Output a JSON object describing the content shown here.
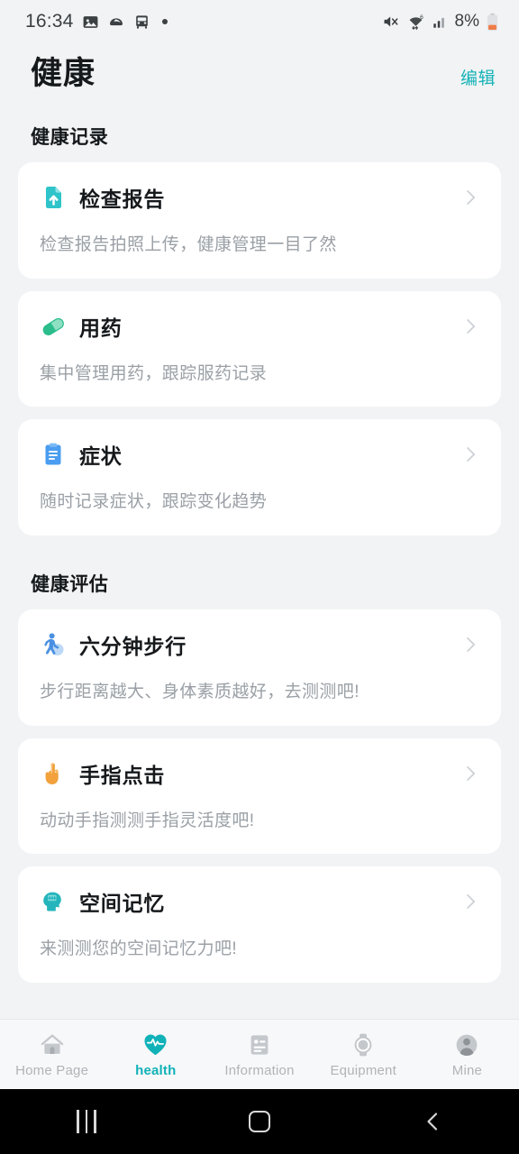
{
  "statusbar": {
    "time": "16:34",
    "left_icons": [
      "image-icon",
      "capsule-icon",
      "bus-icon",
      "dot-indicator"
    ],
    "right_icons": [
      "mute-icon",
      "wifi-icon",
      "signal-icon",
      "battery-icon"
    ],
    "battery_text": "8%",
    "battery_color": "#ef7c48"
  },
  "header": {
    "title": "健康",
    "edit_label": "编辑",
    "accent_color": "#16b3b8"
  },
  "sections": [
    {
      "id": "health-records",
      "title": "健康记录",
      "cards": [
        {
          "id": "inspection-report",
          "icon": "document-upload-icon",
          "icon_color": "#2ec4c9",
          "title": "检查报告",
          "desc": "检查报告拍照上传，健康管理一目了然"
        },
        {
          "id": "medication",
          "icon": "pill-capsule-icon",
          "icon_color": "#2bbd8c",
          "title": "用药",
          "desc": "集中管理用药，跟踪服药记录"
        },
        {
          "id": "symptoms",
          "icon": "clipboard-icon",
          "icon_color": "#4a9df0",
          "title": "症状",
          "desc": "随时记录症状，跟踪变化趋势"
        }
      ]
    },
    {
      "id": "health-assessment",
      "title": "健康评估",
      "cards": [
        {
          "id": "six-minute-walk",
          "icon": "walking-person-icon",
          "icon_color": "#4a90e2",
          "title": "六分钟步行",
          "desc": "步行距离越大、身体素质越好，去测测吧!"
        },
        {
          "id": "finger-tap",
          "icon": "pointing-hand-icon",
          "icon_color": "#f2a13c",
          "title": "手指点击",
          "desc": "动动手指测测手指灵活度吧!"
        },
        {
          "id": "spatial-memory",
          "icon": "brain-head-icon",
          "icon_color": "#23b5bb",
          "title": "空间记忆",
          "desc": "来测测您的空间记忆力吧!"
        }
      ]
    }
  ],
  "tabbar": {
    "active_color": "#10b2b8",
    "inactive_color": "#b0b4b8",
    "items": [
      {
        "id": "home",
        "icon": "home-icon",
        "label": "Home Page",
        "active": false
      },
      {
        "id": "health",
        "icon": "heart-pulse-icon",
        "label": "health",
        "active": true
      },
      {
        "id": "information",
        "icon": "id-card-icon",
        "label": "Information",
        "active": false
      },
      {
        "id": "equipment",
        "icon": "watch-icon",
        "label": "Equipment",
        "active": false
      },
      {
        "id": "mine",
        "icon": "person-icon",
        "label": "Mine",
        "active": false
      }
    ]
  },
  "navbar": {
    "recents_label": "recents-icon",
    "home_label": "home-square-icon",
    "back_label": "back-chevron-icon"
  }
}
